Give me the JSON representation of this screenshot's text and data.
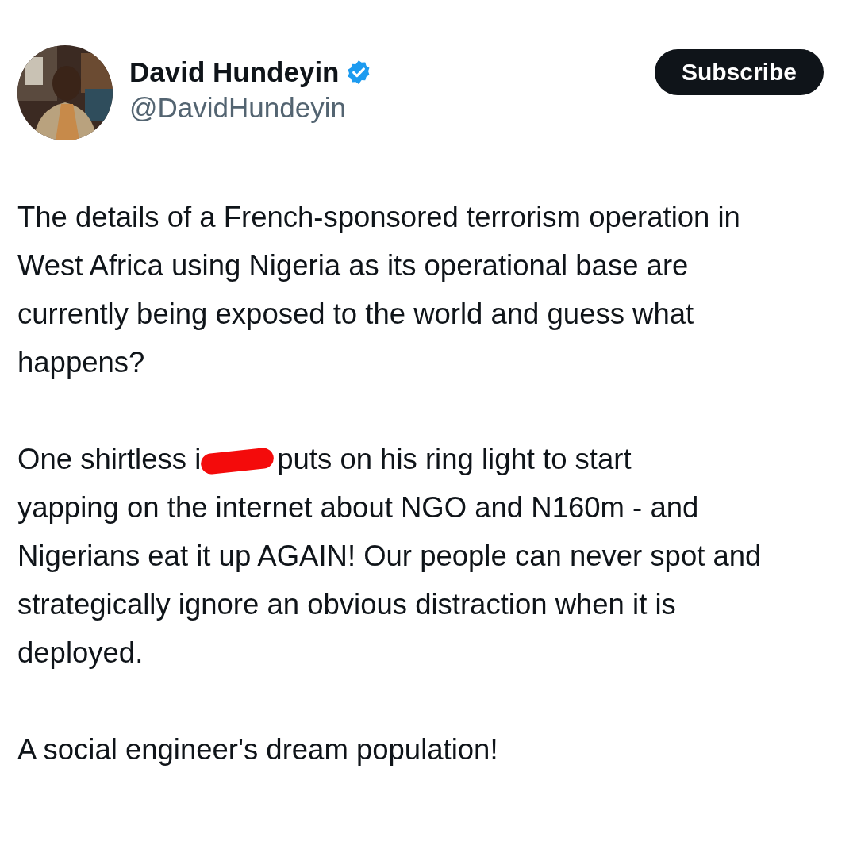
{
  "author": {
    "name": "David Hundeyin",
    "verified": true,
    "handle": "@DavidHundeyin"
  },
  "subscribe_button": {
    "label": "Subscribe"
  },
  "tweet": [
    {
      "kind": "text",
      "text": "The details of a French-sponsored terrorism operation in West Africa using Nigeria as its operational base are currently being exposed to the world and guess what happens?"
    },
    {
      "kind": "redacted",
      "before": "One shirtless i",
      "after": "puts on his ring light to start",
      "rest": "yapping on the internet about NGO and N160m - and Nigerians eat it up AGAIN! Our people can never spot and strategically ignore an obvious distraction when it is deployed."
    },
    {
      "kind": "text",
      "text": "A social engineer's dream population!"
    }
  ]
}
